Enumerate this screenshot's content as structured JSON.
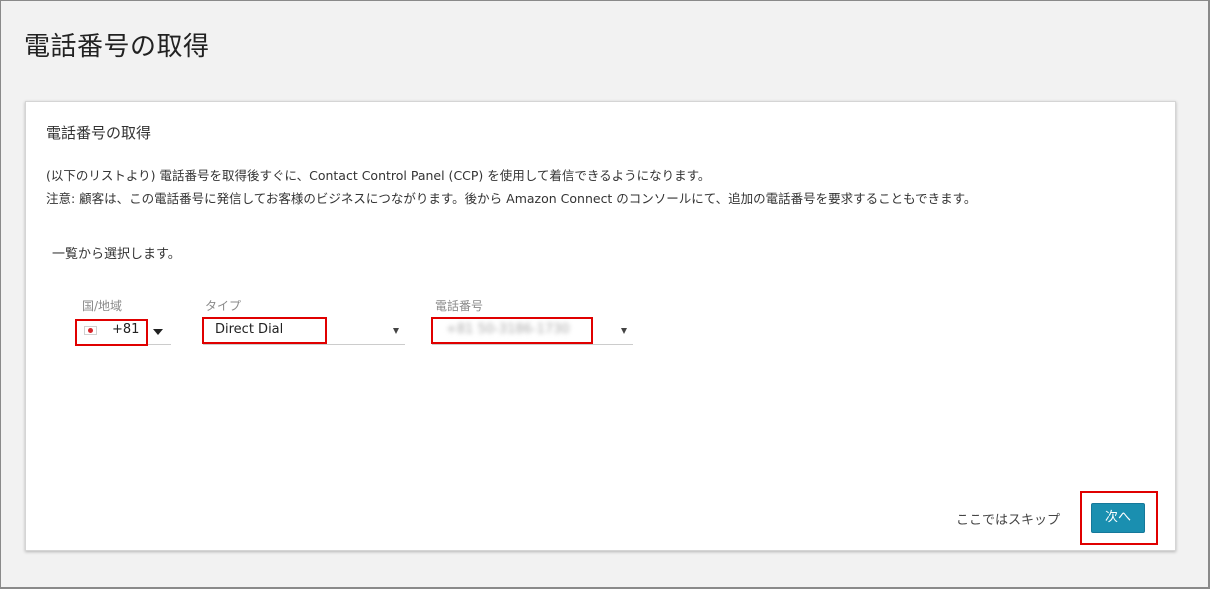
{
  "page": {
    "title": "電話番号の取得"
  },
  "card": {
    "title": "電話番号の取得",
    "description_line1": "(以下のリストより) 電話番号を取得後すぐに、Contact Control Panel (CCP) を使用して着信できるようになります。",
    "description_line2": "注意: 顧客は、この電話番号に発信してお客様のビジネスにつながります。後から Amazon Connect のコンソールにて、追加の電話番号を要求することもできます。",
    "select_prompt": "一覧から選択します。"
  },
  "form": {
    "country": {
      "label": "国/地域",
      "flag_icon": "japan-flag-icon",
      "value": "+81"
    },
    "type": {
      "label": "タイプ",
      "value": "Direct Dial"
    },
    "phone_number": {
      "label": "電話番号",
      "value": "+81 50-3186-1730"
    }
  },
  "actions": {
    "skip_label": "ここではスキップ",
    "next_label": "次へ"
  },
  "colors": {
    "primary_button": "#1a8fb0",
    "highlight": "#e00000",
    "background": "#f2f2f2"
  }
}
